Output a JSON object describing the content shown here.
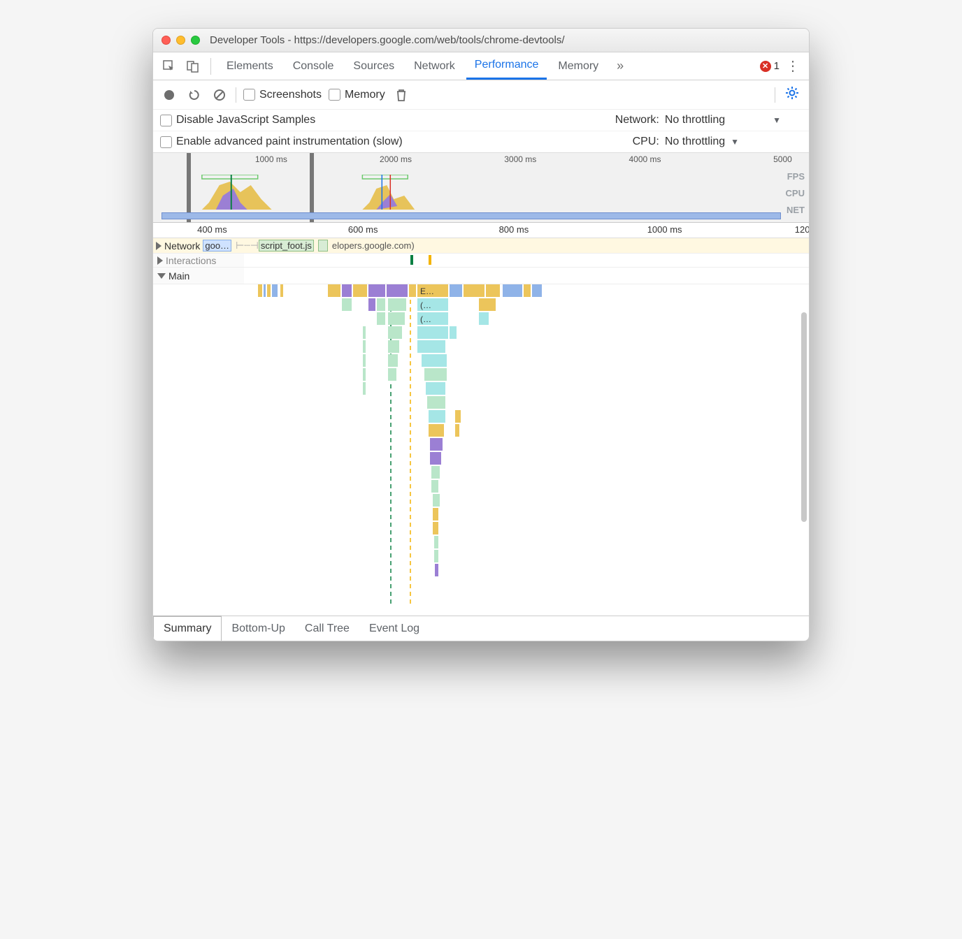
{
  "window": {
    "title": "Developer Tools - https://developers.google.com/web/tools/chrome-devtools/"
  },
  "tabs": {
    "items": [
      "Elements",
      "Console",
      "Sources",
      "Network",
      "Performance",
      "Memory"
    ],
    "active": "Performance",
    "error_count": "1"
  },
  "toolbar": {
    "screenshots": "Screenshots",
    "memory": "Memory"
  },
  "settings": {
    "disable_js": "Disable JavaScript Samples",
    "enable_paint": "Enable advanced paint instrumentation (slow)",
    "network_label": "Network:",
    "network_value": "No throttling",
    "cpu_label": "CPU:",
    "cpu_value": "No throttling"
  },
  "overview": {
    "ticks": [
      "1000 ms",
      "2000 ms",
      "3000 ms",
      "4000 ms",
      "5000"
    ],
    "metrics": [
      "FPS",
      "CPU",
      "NET"
    ]
  },
  "ruler": {
    "ticks": [
      "400 ms",
      "600 ms",
      "800 ms",
      "1000 ms",
      "120"
    ]
  },
  "tracks": {
    "network": "Network",
    "network_item1": "goo…",
    "network_item2": "script_foot.js",
    "network_rest": "elopers.google.com)",
    "interactions": "Interactions",
    "main": "Main",
    "flame_e": "E…",
    "flame_anon1": "(…",
    "flame_anon2": "(…"
  },
  "footer": {
    "tabs": [
      "Summary",
      "Bottom-Up",
      "Call Tree",
      "Event Log"
    ],
    "active": "Summary"
  }
}
